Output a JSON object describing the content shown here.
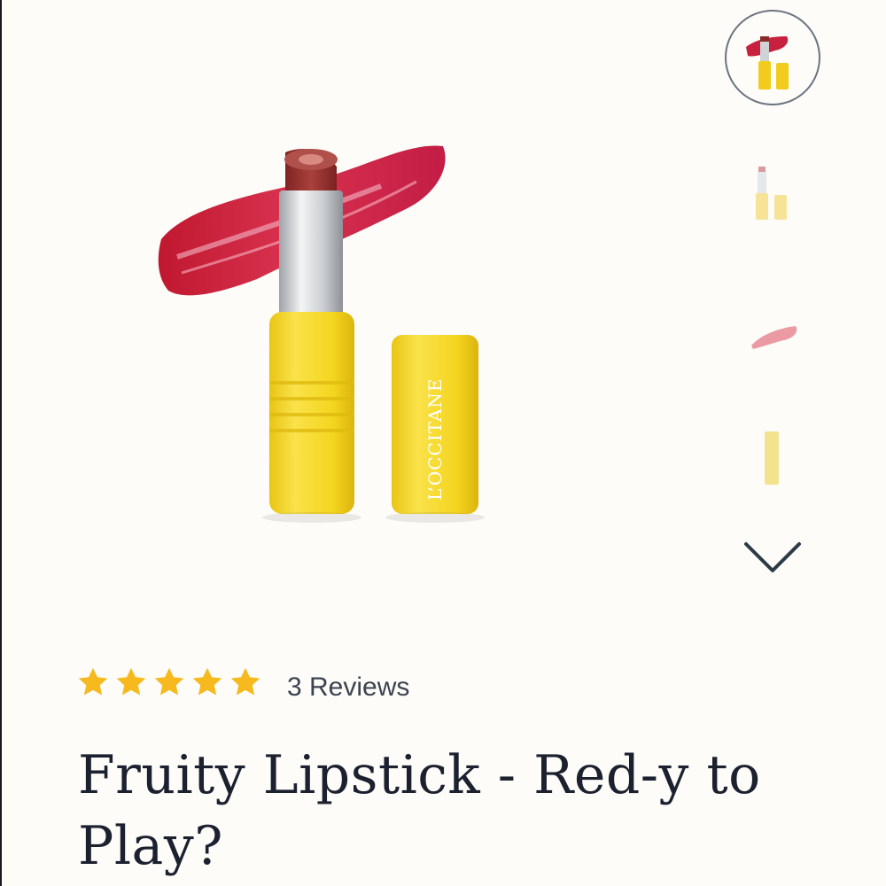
{
  "product": {
    "brand_mark": "L'OCCITANE",
    "title": "Fruity Lipstick - Red-y to Play?",
    "rating": 5,
    "rating_max": 5,
    "reviews_label": "3 Reviews"
  },
  "gallery": {
    "thumbnails": [
      {
        "name": "lipstick-open-with-cap",
        "active": true
      },
      {
        "name": "lipstick-closed-pastel",
        "active": false
      },
      {
        "name": "lipstick-swatch",
        "active": false
      },
      {
        "name": "lipstick-tube-side",
        "active": false
      }
    ],
    "more_icon": "chevron-down-icon"
  },
  "colors": {
    "background": "#fdfcf8",
    "star": "#f6b91e",
    "packaging_yellow": "#f6dc2a",
    "lipstick_red": "#9b2f2e",
    "swatch_red": "#c81e3c",
    "title_text": "#1c2130"
  }
}
